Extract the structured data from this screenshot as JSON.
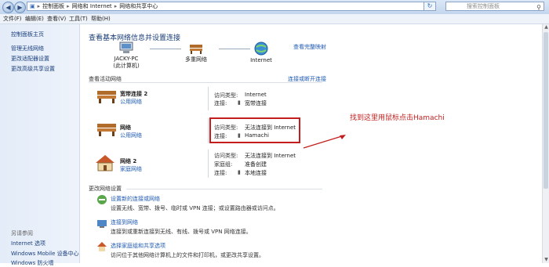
{
  "address_bar": {
    "crumbs": [
      "控制面板",
      "网络和 Internet",
      "网络和共享中心"
    ],
    "search_placeholder": "搜索控制面板"
  },
  "menu": {
    "items": [
      "文件(F)",
      "编辑(E)",
      "查看(V)",
      "工具(T)",
      "帮助(H)"
    ]
  },
  "sidebar": {
    "items": [
      "控制面板主页",
      "管理无线网络",
      "更改适配器设置",
      "更改高级共享设置"
    ],
    "see_also_label": "另请参阅",
    "see_also": [
      "Internet 选项",
      "Windows Mobile 设备中心",
      "Windows 防火墙"
    ]
  },
  "main": {
    "title": "查看基本网络信息并设置连接",
    "full_map_link": "查看完整映射",
    "map": {
      "pc_name": "JACKY-PC",
      "pc_sub": "(此计算机)",
      "multi": "多重网络",
      "internet": "Internet"
    },
    "active_title": "查看活动网络",
    "connect_link": "连接或断开连接",
    "networks": [
      {
        "name": "宽带连接 2",
        "type": "公用网络",
        "access_label": "访问类型:",
        "access": "Internet",
        "conn_label": "连接:",
        "conn": "宽带连接"
      },
      {
        "name": "网络",
        "type": "公用网络",
        "access_label": "访问类型:",
        "access": "无法连接到 Internet",
        "conn_label": "连接:",
        "conn": "Hamachi"
      },
      {
        "name": "网络 2",
        "type": "家庭网络",
        "access_label": "访问类型:",
        "access": "无法连接到 Internet",
        "home_label": "家庭组:",
        "home": "准备创建",
        "conn_label": "连接:",
        "conn": "本地连接"
      }
    ],
    "annotation": "找到这里用鼠标点击Hamachi",
    "change_title": "更改网络设置",
    "tasks": [
      {
        "title": "设置新的连接或网络",
        "desc": "设置无线、宽带、拨号、临时或 VPN 连接；或设置路由器或访问点。"
      },
      {
        "title": "连接到网络",
        "desc": "连接到或重新连接到无线、有线、拨号或 VPN 网络连接。"
      },
      {
        "title": "选择家庭组和共享选项",
        "desc": "访问位于其他网络计算机上的文件和打印机，或更改共享设置。"
      }
    ]
  },
  "colors": {
    "highlight": "#c31d1d",
    "link": "#1f5ab3"
  }
}
